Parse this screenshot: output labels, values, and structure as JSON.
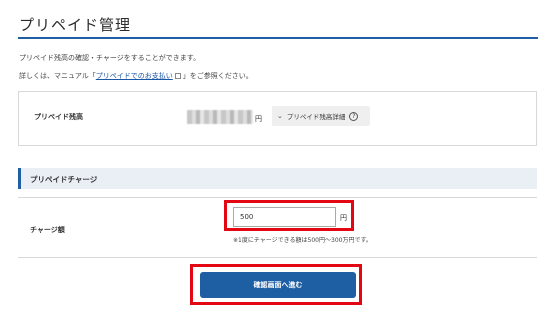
{
  "page": {
    "title": "プリペイド管理"
  },
  "intro": {
    "line1": "プリペイド残高の確認・チャージをすることができます。",
    "line2_prefix": "詳しくは、マニュアル「",
    "line2_link": "プリペイドでのお支払い",
    "line2_suffix": "」をご参照ください。"
  },
  "balance": {
    "label": "プリペイド残高",
    "currency": "円",
    "detail_button": "プリペイド残高詳細",
    "help_glyph": "?"
  },
  "charge": {
    "section_title": "プリペイドチャージ",
    "amount_label": "チャージ額",
    "amount_value": "500",
    "amount_unit": "円",
    "note": "※1度にチャージできる額は500円〜300万円です。",
    "confirm_button": "確認画面へ進む"
  },
  "icons": {
    "external_link": "external-link-icon",
    "chevron": "chevron-down-icon",
    "help": "help-circle-icon"
  },
  "colors": {
    "accent": "#1f5fa6",
    "button": "#1e5ea3",
    "highlight": "#e30613",
    "section_bg": "#eaeff6"
  }
}
